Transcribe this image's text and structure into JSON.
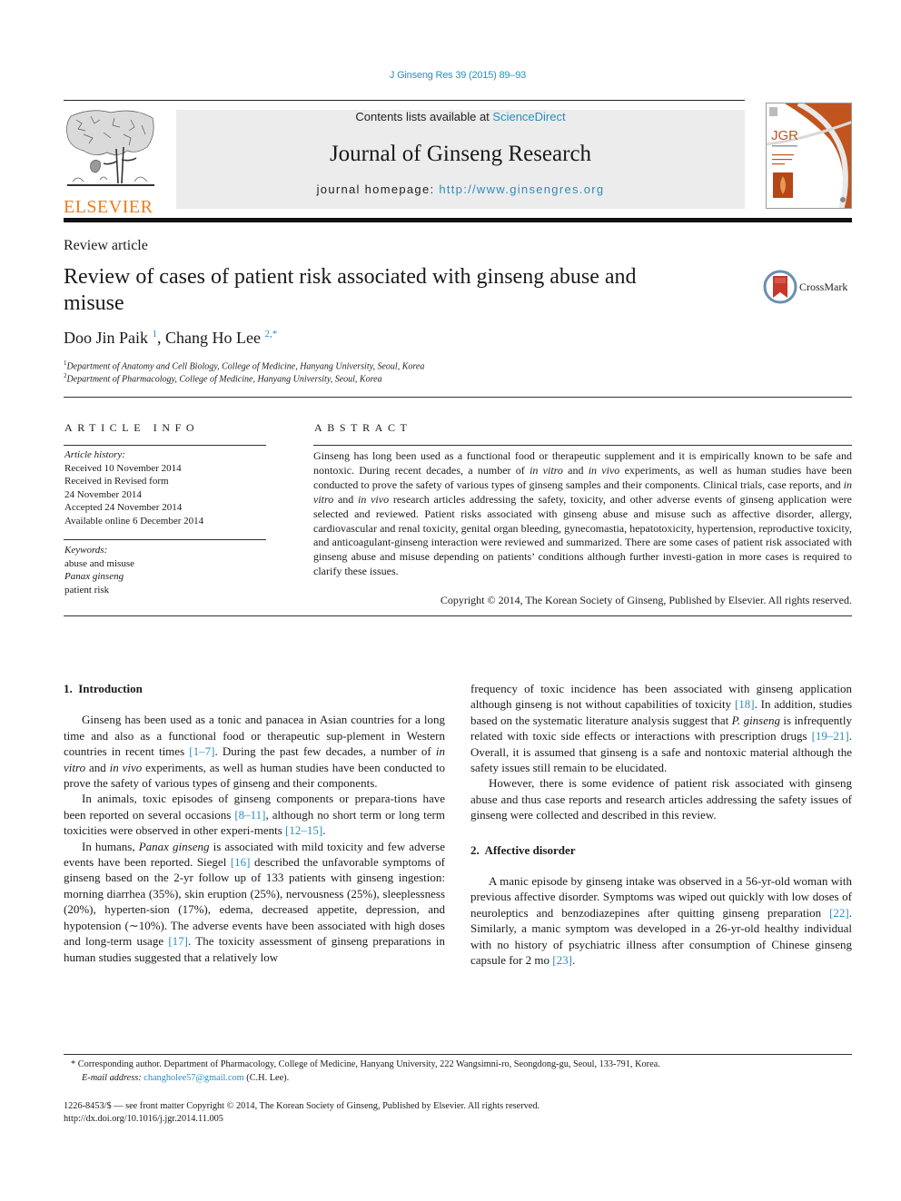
{
  "citation": "J Ginseng Res 39 (2015) 89–93",
  "header": {
    "publisher_logo_text": "ELSEVIER",
    "contents_prefix": "Contents lists available at ",
    "contents_link": "ScienceDirect",
    "journal_title": "Journal of Ginseng Research",
    "homepage_prefix": "journal homepage: ",
    "homepage_link": "http://www.ginsengres.org",
    "cover_abbrev": "JGR"
  },
  "article": {
    "type": "Review article",
    "title": "Review of cases of patient risk associated with ginseng abuse and misuse",
    "crossmark_label": "CrossMark",
    "authors": [
      {
        "name": "Doo Jin Paik",
        "sup": "1"
      },
      {
        "name": "Chang Ho Lee",
        "sup": "2,*"
      }
    ],
    "author_separator": ", ",
    "affiliations": [
      {
        "num": "1",
        "text": "Department of Anatomy and Cell Biology, College of Medicine, Hanyang University, Seoul, Korea"
      },
      {
        "num": "2",
        "text": "Department of Pharmacology, College of Medicine, Hanyang University, Seoul, Korea"
      }
    ]
  },
  "article_info": {
    "heading": "ARTICLE INFO",
    "history_label": "Article history:",
    "history": [
      "Received 10 November 2014",
      "Received in Revised form",
      "24 November 2014",
      "Accepted 24 November 2014",
      "Available online 6 December 2014"
    ],
    "keywords_label": "Keywords:",
    "keywords": [
      "abuse and misuse",
      "Panax ginseng",
      "patient risk"
    ]
  },
  "abstract": {
    "heading": "ABSTRACT",
    "segments": [
      {
        "t": "Ginseng has long been used as a functional food or therapeutic supplement and it is empirically known to be safe and nontoxic. During recent decades, a number of "
      },
      {
        "t": "in vitro",
        "i": true
      },
      {
        "t": " and "
      },
      {
        "t": "in vivo",
        "i": true
      },
      {
        "t": " experiments, as well as human studies have been conducted to prove the safety of various types of ginseng samples and their components. Clinical trials, case reports, and "
      },
      {
        "t": "in vitro",
        "i": true
      },
      {
        "t": " and "
      },
      {
        "t": "in vivo",
        "i": true
      },
      {
        "t": " research articles addressing the safety, toxicity, and other adverse events of ginseng application were selected and reviewed. Patient risks associated with ginseng abuse and misuse such as affective disorder, allergy, cardiovascular and renal toxicity, genital organ bleeding, gynecomastia, hepatotoxicity, hypertension, reproductive toxicity, and anticoagulant-ginseng interaction were reviewed and summarized. There are some cases of patient risk associated with ginseng abuse and misuse depending on patients’ conditions although further investi-gation in more cases is required to clarify these issues."
      }
    ],
    "copyright": "Copyright © 2014, The Korean Society of Ginseng, Published by Elsevier. All rights reserved."
  },
  "body": {
    "sections": [
      {
        "heading": "1.  Introduction"
      },
      {
        "heading": "2.  Affective disorder"
      }
    ],
    "left_paragraphs": [
      [
        {
          "t": "Ginseng has been used as a tonic and panacea in Asian countries for a long time and also as a functional food or therapeutic sup-plement in Western countries in recent times "
        },
        {
          "t": "[1–7]",
          "c": true
        },
        {
          "t": ". During the past few decades, a number of "
        },
        {
          "t": "in vitro",
          "i": true
        },
        {
          "t": " and "
        },
        {
          "t": "in vivo",
          "i": true
        },
        {
          "t": " experiments, as well as human studies have been conducted to prove the safety of various types of ginseng and their components."
        }
      ],
      [
        {
          "t": "In animals, toxic episodes of ginseng components or prepara-tions have been reported on several occasions "
        },
        {
          "t": "[8–11]",
          "c": true
        },
        {
          "t": ", although no short term or long term toxicities were observed in other experi-ments "
        },
        {
          "t": "[12–15]",
          "c": true
        },
        {
          "t": "."
        }
      ],
      [
        {
          "t": "In humans, "
        },
        {
          "t": "Panax ginseng",
          "i": true
        },
        {
          "t": " is associated with mild toxicity and few adverse events have been reported. Siegel "
        },
        {
          "t": "[16]",
          "c": true
        },
        {
          "t": " described the unfavorable symptoms of ginseng based on the 2-yr follow up of 133 patients with ginseng ingestion: morning diarrhea (35%), skin eruption (25%), nervousness (25%), sleeplessness (20%), hyperten-sion (17%), edema, decreased appetite, depression, and hypotension (∼10%). The adverse events have been associated with high doses and long-term usage "
        },
        {
          "t": "[17]",
          "c": true
        },
        {
          "t": ". The toxicity assessment of ginseng preparations in human studies suggested that a relatively low"
        }
      ]
    ],
    "right_paragraphs": [
      [
        {
          "t": "frequency of toxic incidence has been associated with ginseng application although ginseng is not without capabilities of toxicity "
        },
        {
          "t": "[18]",
          "c": true
        },
        {
          "t": ". In addition, studies based on the systematic literature analysis suggest that "
        },
        {
          "t": "P. ginseng",
          "i": true
        },
        {
          "t": " is infrequently related with toxic side effects or interactions with prescription drugs "
        },
        {
          "t": "[19–21]",
          "c": true
        },
        {
          "t": ". Overall, it is assumed that ginseng is a safe and nontoxic material although the safety issues still remain to be elucidated."
        }
      ],
      [
        {
          "t": "However, there is some evidence of patient risk associated with ginseng abuse and thus case reports and research articles addressing the safety issues of ginseng were collected and described in this review."
        }
      ]
    ],
    "section2_paragraphs": [
      [
        {
          "t": "A manic episode by ginseng intake was observed in a 56-yr-old woman with previous affective disorder. Symptoms was wiped out quickly with low doses of neuroleptics and benzodiazepines after quitting ginseng preparation "
        },
        {
          "t": "[22]",
          "c": true
        },
        {
          "t": ". Similarly, a manic symptom was developed in a 26-yr-old healthy individual with no history of psychiatric illness after consumption of Chinese ginseng capsule for 2 mo "
        },
        {
          "t": "[23]",
          "c": true
        },
        {
          "t": "."
        }
      ]
    ]
  },
  "footer": {
    "corresponding_marker": "*",
    "corresponding_text": "Corresponding author. Department of Pharmacology, College of Medicine, Hanyang University, 222 Wangsimni-ro, Seongdong-gu, Seoul, 133-791, Korea.",
    "email_label": "E-mail address: ",
    "email": "changholee57@gmail.com",
    "email_suffix": " (C.H. Lee).",
    "issn_line": "1226-8453/$ — see front matter Copyright © 2014, The Korean Society of Ginseng, Published by Elsevier. All rights reserved.",
    "doi": "http://dx.doi.org/10.1016/j.jgr.2014.11.005"
  },
  "colors": {
    "link": "#2a8fbd",
    "elsevier_orange": "#f07c1a",
    "header_box": "#ececec"
  }
}
